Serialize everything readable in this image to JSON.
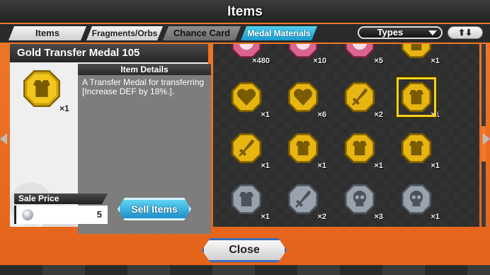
{
  "window": {
    "title": "Items"
  },
  "tabs": [
    {
      "label": "Items",
      "active": false
    },
    {
      "label": "Fragments/Orbs",
      "active": false
    },
    {
      "label": "Chance Card",
      "active": false
    },
    {
      "label": "Medal Materials",
      "active": true
    }
  ],
  "filter": {
    "selected": "Types",
    "sort_label": "⬆⬇"
  },
  "selected_item": {
    "name": "Gold Transfer Medal 105",
    "quantity": "×1",
    "details_header": "Item Details",
    "description": "A Transfer Medal for transferring [Increase DEF by 18%.].",
    "sale_price_label": "Sale Price",
    "sale_price": "5",
    "sell_button": "Sell Items"
  },
  "grid": {
    "rows": [
      [
        {
          "kind": "pink",
          "qty": "×480"
        },
        {
          "kind": "pink",
          "qty": "×10"
        },
        {
          "kind": "pink",
          "qty": "×5"
        },
        {
          "kind": "gold-armor",
          "qty": "×1"
        }
      ],
      [
        {
          "kind": "gold-heart",
          "qty": "×1"
        },
        {
          "kind": "gold-heart",
          "qty": "×6"
        },
        {
          "kind": "gold-sword",
          "qty": "×2"
        },
        {
          "kind": "gold-armor",
          "qty": "×1",
          "selected": true
        }
      ],
      [
        {
          "kind": "gold-sword",
          "qty": "×1"
        },
        {
          "kind": "gold-armor",
          "qty": "×1"
        },
        {
          "kind": "gold-armor",
          "qty": "×1"
        },
        {
          "kind": "gold-armor",
          "qty": "×1"
        }
      ],
      [
        {
          "kind": "silver-armor",
          "qty": "×1"
        },
        {
          "kind": "silver-sword",
          "qty": "×2"
        },
        {
          "kind": "silver-skull",
          "qty": "×3"
        },
        {
          "kind": "silver-skull",
          "qty": "×1"
        }
      ]
    ]
  },
  "footer": {
    "close_label": "Close"
  },
  "colors": {
    "frame_orange": "#f07a2a",
    "active_tab": "#1b9bd0",
    "gold": "#e8b613",
    "silver": "#9aa3ad",
    "pink": "#d9648f",
    "selected": "#f6d11a"
  }
}
